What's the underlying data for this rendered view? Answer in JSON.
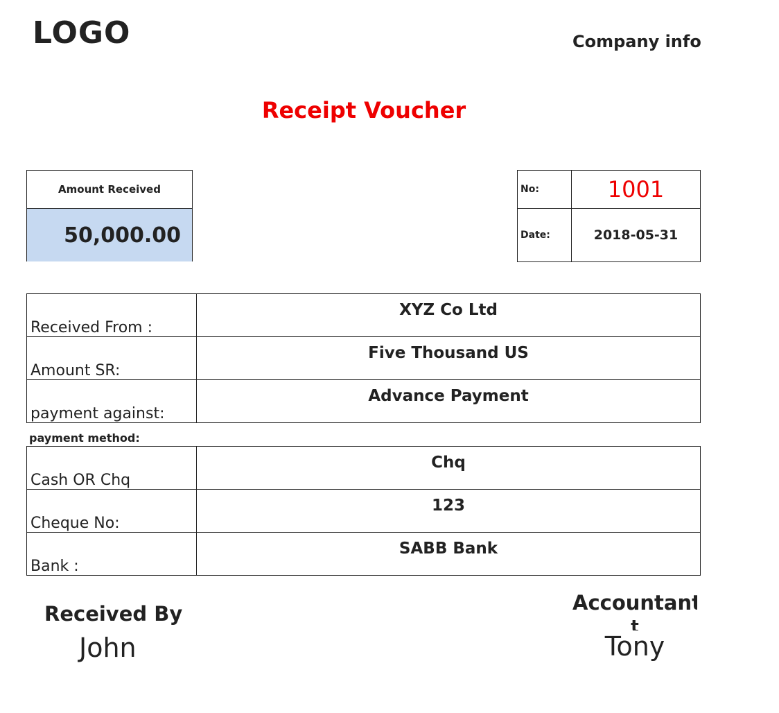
{
  "header": {
    "logo": "LOGO",
    "company_info": "Company info",
    "title": "Receipt Voucher"
  },
  "amount": {
    "label": "Amount Received",
    "value": "50,000.00"
  },
  "voucher": {
    "no_label": "No:",
    "no_value": "1001",
    "date_label": "Date:",
    "date_value": "2018-05-31"
  },
  "details": [
    {
      "label": "Received From :",
      "value": "XYZ Co Ltd"
    },
    {
      "label": "Amount SR:",
      "value": "Five Thousand US"
    },
    {
      "label": "payment against:",
      "value": "Advance Payment"
    }
  ],
  "payment_method": {
    "label": "payment method:",
    "rows": [
      {
        "label": "Cash OR Chq",
        "value": "Chq"
      },
      {
        "label": "Cheque No:",
        "value": "123"
      },
      {
        "label": "Bank :",
        "value": "SABB Bank"
      }
    ]
  },
  "signatures": {
    "received_by_label": "Received By",
    "received_by_name": "John",
    "accountant_label": "Accountant",
    "accountant_name": "Tony"
  },
  "colors": {
    "title": "#ee0000",
    "amount_fill": "#c6d9f1",
    "voucher_no": "#ee0000"
  }
}
